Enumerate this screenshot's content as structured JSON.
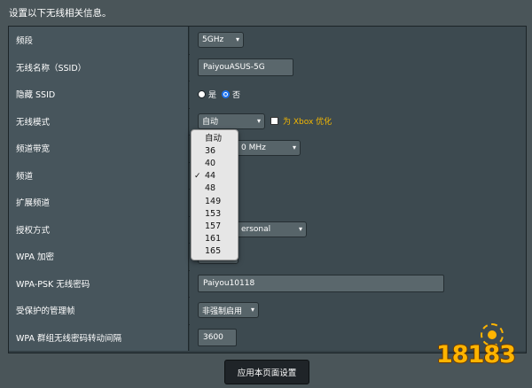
{
  "header": {
    "intro": "设置以下无线相关信息。"
  },
  "rows": {
    "band": {
      "label": "频段",
      "value": "5GHz"
    },
    "ssid": {
      "label": "无线名称（SSID）",
      "value": "PaiyouASUS-5G"
    },
    "hide_ssid": {
      "label": "隐藏 SSID",
      "option_yes": "是",
      "option_no": "否",
      "selected": "否"
    },
    "wireless_mode": {
      "label": "无线模式",
      "value": "自动",
      "xbox_option": "为 Xbox 优化"
    },
    "channel_bandwidth": {
      "label": "频道带宽",
      "value_partial": "0 MHz"
    },
    "channel": {
      "label": "频道"
    },
    "extension_channel": {
      "label": "扩展频道"
    },
    "auth_method": {
      "label": "授权方式",
      "value_partial": "ersonal"
    },
    "wpa_encryption": {
      "label": "WPA 加密"
    },
    "wpa_psk": {
      "label": "WPA-PSK 无线密码",
      "value": "Paiyou10118"
    },
    "pmf": {
      "label": "受保护的管理帧",
      "value": "非强制启用"
    },
    "rekey": {
      "label": "WPA 群组无线密码转动间隔",
      "value": "3600"
    }
  },
  "channel_dropdown": {
    "options": [
      "自动",
      "36",
      "40",
      "44",
      "48",
      "149",
      "153",
      "157",
      "161",
      "165"
    ],
    "selected": "44"
  },
  "apply_button": {
    "label": "应用本页面设置"
  },
  "watermark": {
    "text": "18183"
  },
  "colors": {
    "background": "#4a5559",
    "label_bg": "#47555c",
    "value_bg": "#3d4a50",
    "accent_yellow": "#f5b800",
    "radio_blue": "#1e73f0"
  }
}
